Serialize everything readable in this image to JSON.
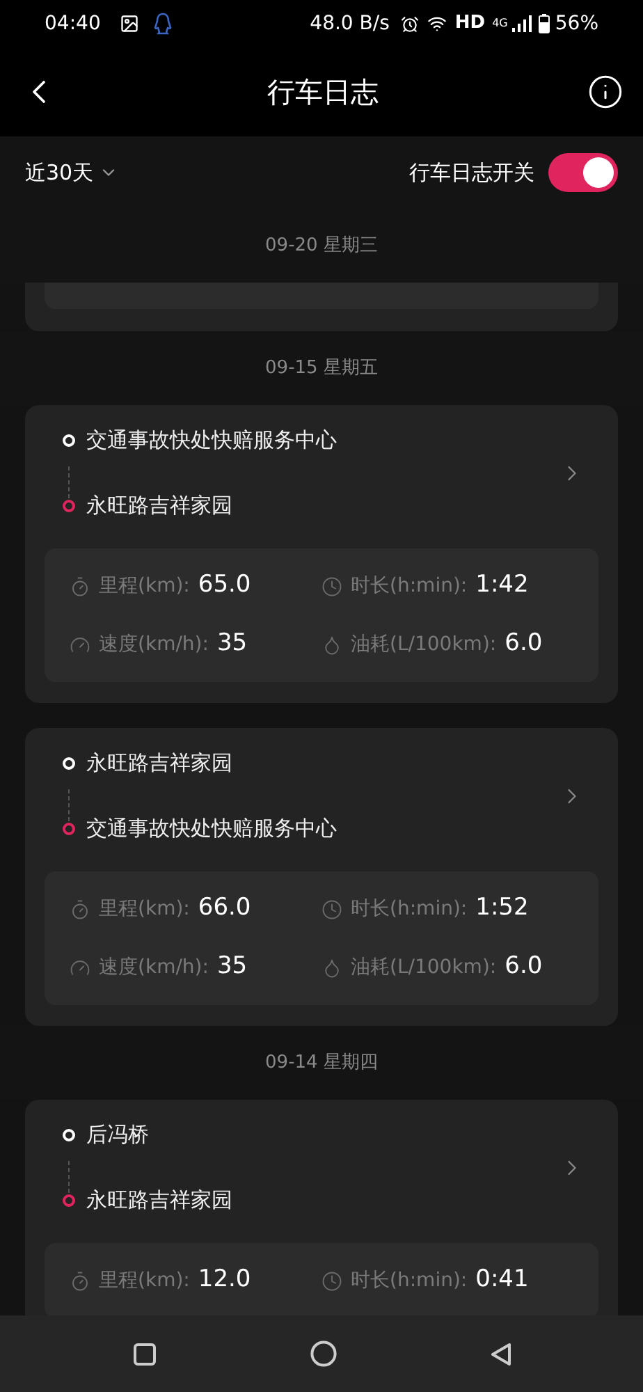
{
  "status_bar": {
    "time": "04:40",
    "net_speed": "48.0 B/s",
    "hd": "HD",
    "network": "4G",
    "battery": "56%"
  },
  "header": {
    "title": "行车日志"
  },
  "filter": {
    "range": "近30天",
    "switch_label": "行车日志开关",
    "on": true
  },
  "groups": [
    {
      "date": "09-20 星期三",
      "kind": "cut_off"
    },
    {
      "date": "09-15 星期五",
      "kind": "trips",
      "trips": [
        {
          "from": "交通事故快处快赔服务中心",
          "to": "永旺路吉祥家园",
          "stats": [
            {
              "kind": "distance",
              "label": "里程(km):",
              "value": "65.0"
            },
            {
              "kind": "duration",
              "label": "时长(h:min):",
              "value": "1:42"
            },
            {
              "kind": "speed",
              "label": "速度(km/h):",
              "value": "35"
            },
            {
              "kind": "fuel",
              "label": "油耗(L/100km):",
              "value": "6.0"
            }
          ]
        },
        {
          "from": "永旺路吉祥家园",
          "to": "交通事故快处快赔服务中心",
          "stats": [
            {
              "kind": "distance",
              "label": "里程(km):",
              "value": "66.0"
            },
            {
              "kind": "duration",
              "label": "时长(h:min):",
              "value": "1:52"
            },
            {
              "kind": "speed",
              "label": "速度(km/h):",
              "value": "35"
            },
            {
              "kind": "fuel",
              "label": "油耗(L/100km):",
              "value": "6.0"
            }
          ]
        }
      ]
    },
    {
      "date": "09-14 星期四",
      "kind": "trips",
      "trips": [
        {
          "from": "后冯桥",
          "to": "永旺路吉祥家园",
          "stats": [
            {
              "kind": "distance",
              "label": "里程(km):",
              "value": "12.0"
            },
            {
              "kind": "duration",
              "label": "时长(h:min):",
              "value": "0:41"
            }
          ]
        }
      ]
    }
  ]
}
